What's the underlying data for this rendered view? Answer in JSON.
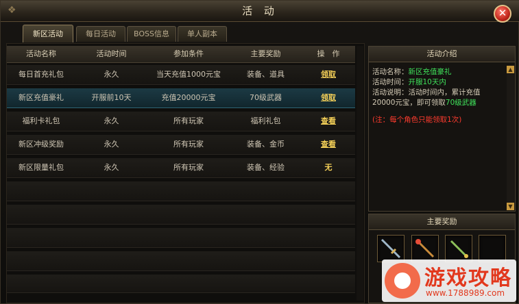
{
  "window": {
    "title": "活 动",
    "close_label": "✕"
  },
  "tabs": [
    {
      "label": "新区活动",
      "active": true
    },
    {
      "label": "每日活动",
      "active": false
    },
    {
      "label": "BOSS信息",
      "active": false
    },
    {
      "label": "单人副本",
      "active": false
    }
  ],
  "table": {
    "headers": [
      "活动名称",
      "活动时间",
      "参加条件",
      "主要奖励",
      "操　作"
    ],
    "rows": [
      {
        "name": "每日首充礼包",
        "time": "永久",
        "condition": "当天充值1000元宝",
        "reward": "装备、道具",
        "action": "领取"
      },
      {
        "name": "新区充值豪礼",
        "time": "开服前10天",
        "condition": "充值20000元宝",
        "reward": "70级武器",
        "action": "领取"
      },
      {
        "name": "福利卡礼包",
        "time": "永久",
        "condition": "所有玩家",
        "reward": "福利礼包",
        "action": "查看"
      },
      {
        "name": "新区冲级奖励",
        "time": "永久",
        "condition": "所有玩家",
        "reward": "装备、金币",
        "action": "查看"
      },
      {
        "name": "新区限量礼包",
        "time": "永久",
        "condition": "所有玩家",
        "reward": "装备、经验",
        "action": "无"
      }
    ]
  },
  "intro": {
    "title": "活动介绍",
    "name_label": "活动名称：",
    "name_value": "新区充值豪礼",
    "time_label": "活动时间：",
    "time_value": "开服10天内",
    "desc_label": "活动说明：",
    "desc_text": "活动时间内，累计充值20000元宝，即可领取",
    "desc_highlight": "70级武器",
    "note": "(注：每个角色只能领取1次)"
  },
  "rewards": {
    "title": "主要奖励"
  },
  "watermark": {
    "text": "游戏攻略",
    "url": "www.1788989.com"
  },
  "colors": {
    "highlight": "#3fe05a",
    "note": "#ff3b2e",
    "action": "#f3cf58",
    "selected_row": "#1c3a44"
  },
  "icons": [
    "close-icon",
    "scroll-up-icon",
    "scroll-down-icon",
    "sword-icon",
    "staff-icon",
    "dagger-icon"
  ]
}
